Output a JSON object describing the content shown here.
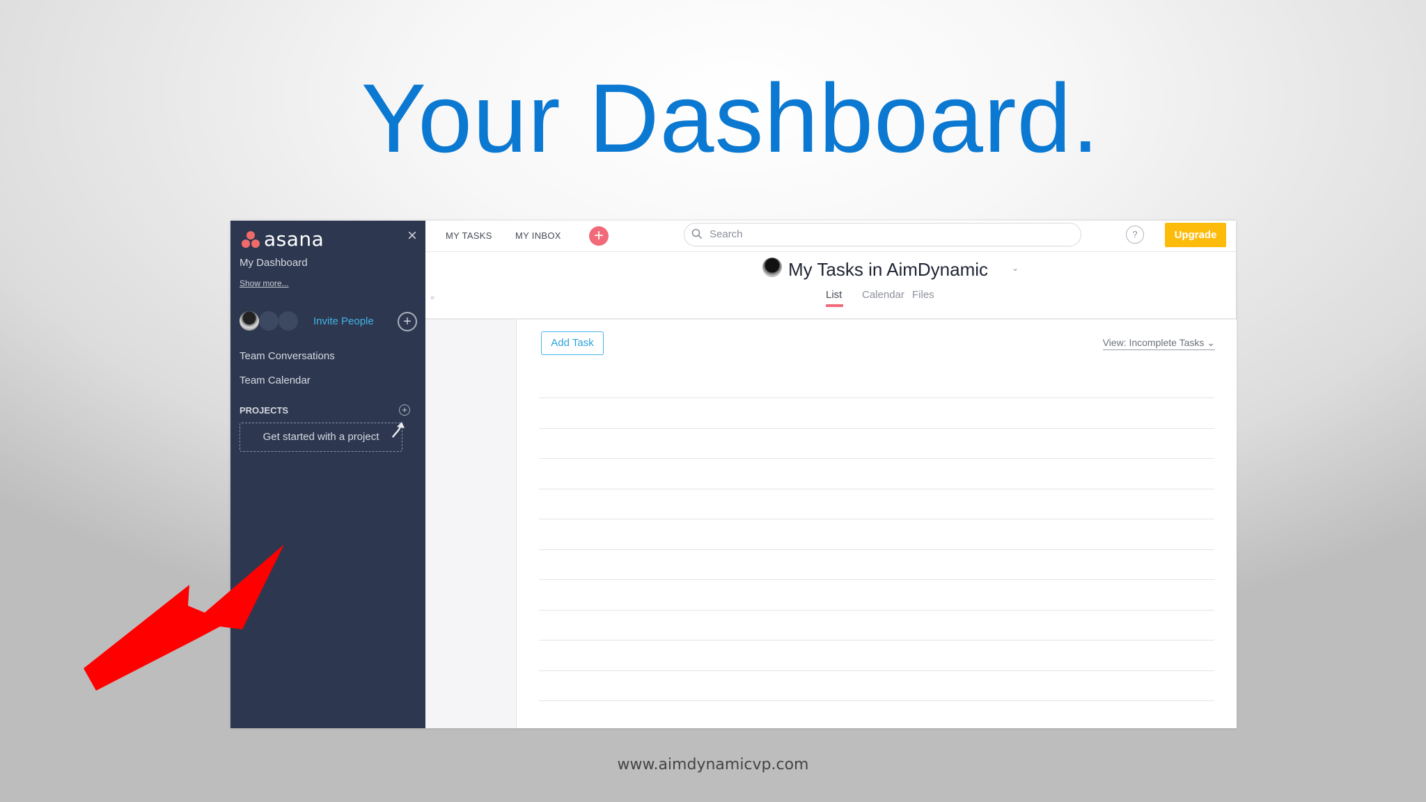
{
  "slide": {
    "title": "Your Dashboard.",
    "footer": "www.aimdynamicvp.com"
  },
  "sidebar": {
    "logo_text": "asana",
    "close_icon": "×",
    "my_dashboard": "My Dashboard",
    "show_more": "Show more...",
    "invite_people": "Invite People",
    "plus_icon": "+",
    "nav": [
      "Team Conversations",
      "Team Calendar"
    ],
    "projects_heading": "PROJECTS",
    "get_started": "Get started with a project"
  },
  "topbar": {
    "tabs": [
      "MY TASKS",
      "MY INBOX"
    ],
    "add_icon": "+",
    "search_placeholder": "Search",
    "help_icon": "?",
    "upgrade": "Upgrade"
  },
  "header": {
    "title": "My Tasks in AimDynamic",
    "caret": "⌄",
    "collapse_icon": "«",
    "tabs": [
      "List",
      "Calendar",
      "Files"
    ],
    "active_tab": "List"
  },
  "tasks": {
    "add_task": "Add Task",
    "view_filter": "View: Incomplete Tasks ⌄"
  },
  "colors": {
    "title_blue": "#0b78d1",
    "sidebar_bg": "#2d3850",
    "asana_coral": "#f06a7a",
    "upgrade_yellow": "#fdbb0c",
    "link_blue": "#43b2e6",
    "annotation_red": "#ff0000"
  },
  "icons": [
    "asana-logo-icon",
    "close-icon",
    "plus-icon",
    "search-icon",
    "help-icon",
    "chevron-down-icon",
    "collapse-icon",
    "curved-arrow-icon",
    "red-pointer-arrow"
  ]
}
